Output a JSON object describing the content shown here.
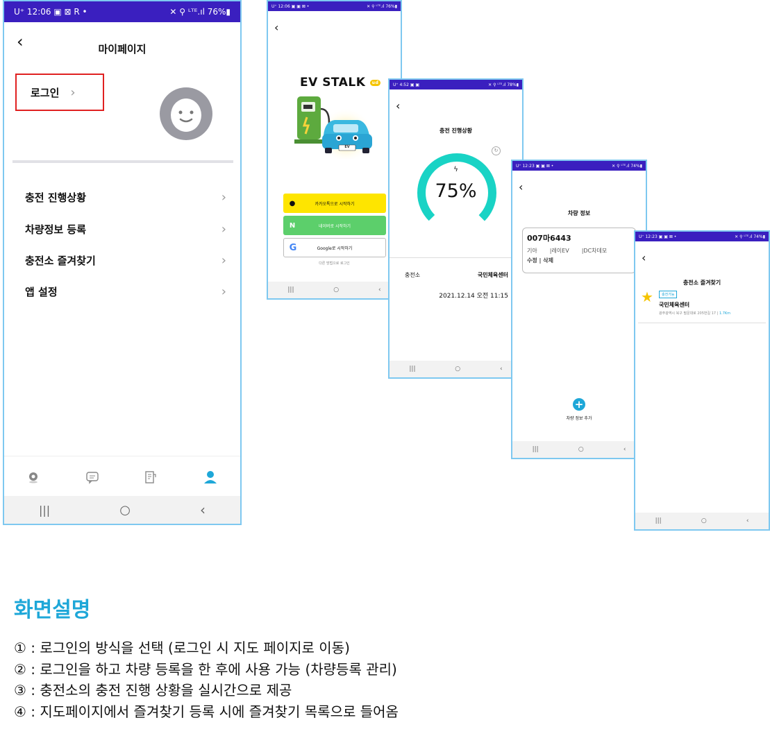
{
  "phone1": {
    "status": {
      "left": "U⁺ 12:06 ▣ ⊠ R •",
      "right": "✕ ⚲ ᴸᵀᴱ.ıl 76%▮"
    },
    "title": "마이페이지",
    "login_label": "로그인",
    "menu": [
      {
        "label": "충전 진행상황"
      },
      {
        "label": "차량정보 등록"
      },
      {
        "label": "충전소 즐겨찾기"
      },
      {
        "label": "앱 설정"
      }
    ],
    "tab_icons": [
      "map-pin-icon",
      "chat-icon",
      "receipt-icon",
      "person-icon"
    ],
    "accent": "#1ea7d8"
  },
  "phone2": {
    "status": {
      "left": "U⁺ 12:06 ▣ ▣ ⊠ •",
      "right": "✕ ⚲ ᴸᵀᴱ.ıl 76%▮"
    },
    "brand": "EV STALK",
    "brand_badge": "ud",
    "car_plate": "EV",
    "kakao_label": "카카오톡으로 시작하기",
    "naver_label": "네이버로 시작하기",
    "google_label": "Google로 시작하기",
    "other_label": "다른 방법으로 로그인",
    "colors": {
      "kakao": "#fee500",
      "naver": "#5ccf6b"
    }
  },
  "phone3": {
    "status": {
      "left": "U⁺ 4:52 ▣ ▣",
      "right": "✕ ⚲ ᴸᵀᴱ.ıl 78%▮"
    },
    "title": "충전 진행상황",
    "percent_text": "75%",
    "progress": 0.75,
    "station_label": "충전소",
    "station_name": "국민체육센터",
    "datetime": "2021.12.14 오전 11:15",
    "accent": "#19d3c5"
  },
  "phone4": {
    "status": {
      "left": "U⁺ 12:23 ▣ ▣ ⊠ •",
      "right": "✕ ⚲ ᴸᵀᴱ.ıl 74%▮"
    },
    "title": "차량 정보",
    "plate": "007마6443",
    "maker": "기아",
    "model": "|레이EV",
    "charger": "|DC차데모",
    "edit_delete": "수정 | 삭제",
    "add_label": "차량 정보 추가"
  },
  "phone5": {
    "status": {
      "left": "U⁺ 12:23 ▣ ▣ ⊠ •",
      "right": "✕ ⚲ ᴸᵀᴱ.ıl 74%▮"
    },
    "title": "충전소 즐겨찾기",
    "badge": "충전가능",
    "station_name": "국민체육센터",
    "address": "광주광역시 북구 필문대로 205번길 17 |",
    "distance": "1.7Km"
  },
  "description": {
    "heading": "화면설명",
    "lines": [
      "① : 로그인의 방식을 선택 (로그인 시 지도 페이지로 이동)",
      "② : 로그인을 하고 차량 등록을 한 후에 사용 가능 (차량등록 관리)",
      "③ : 충전소의 충전 진행 상황을 실시간으로 제공",
      "④ : 지도페이지에서 즐겨찾기 등록 시에 즐겨찾기 목록으로 들어옴"
    ],
    "heading_color": "#1ea7d8"
  }
}
